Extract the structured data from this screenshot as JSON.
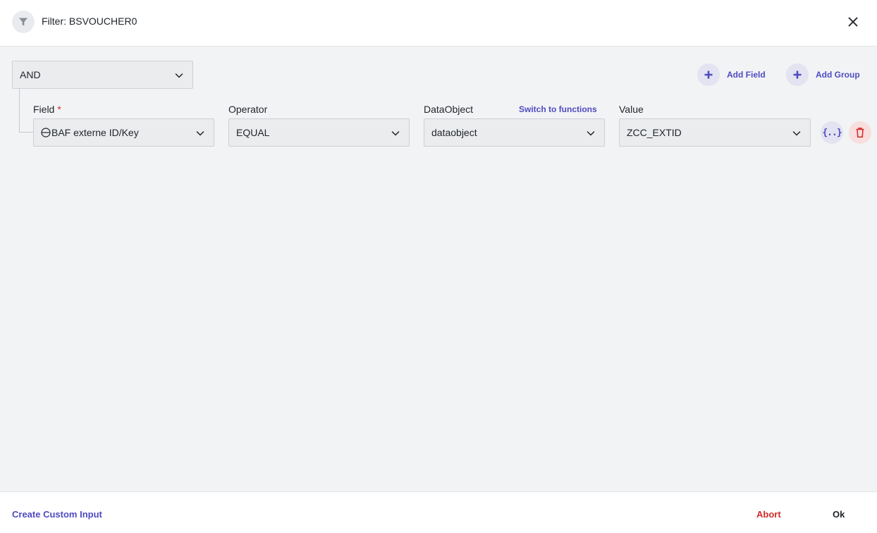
{
  "header": {
    "title": "Filter: BSVOUCHER0",
    "filter_icon": "filter-icon",
    "close_icon": "close-icon"
  },
  "group": {
    "logic_value": "AND",
    "add_field_label": "Add Field",
    "add_group_label": "Add Group"
  },
  "condition": {
    "field": {
      "label": "Field",
      "required_mark": "*",
      "value": "BAF externe ID/Key",
      "value_icon": "minus-circle-icon"
    },
    "operator": {
      "label": "Operator",
      "value": "EQUAL"
    },
    "data_object": {
      "label": "DataObject",
      "switch_label": "Switch to functions",
      "value": "dataobject"
    },
    "value": {
      "label": "Value",
      "value": "ZCC_EXTID"
    },
    "function_button_text": "{..}",
    "delete_icon": "trash-icon"
  },
  "footer": {
    "create_custom_label": "Create Custom Input",
    "abort_label": "Abort",
    "ok_label": "Ok"
  },
  "colors": {
    "accent": "#4f4bc1",
    "danger": "#cf2b2b",
    "content_bg": "#f2f3f5"
  }
}
